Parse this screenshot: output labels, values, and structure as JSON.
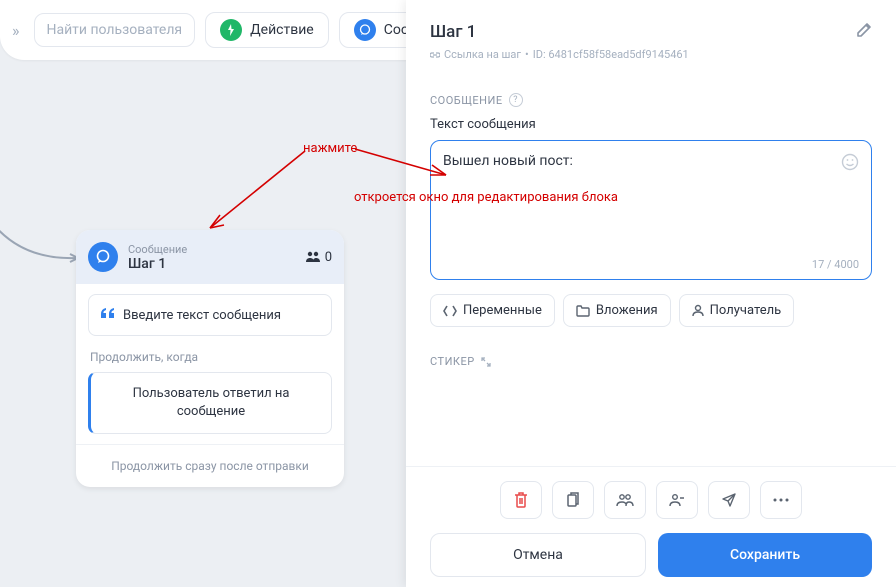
{
  "toolbar": {
    "search_placeholder": "Найти пользователя",
    "action_label": "Действие",
    "message_label": "Сооб"
  },
  "node": {
    "type_label": "Сообщение",
    "title": "Шаг 1",
    "user_count": "0",
    "enter_text": "Введите текст сообщения",
    "continue_label": "Продолжить, когда",
    "continue_text": "Пользователь ответил на сообщение",
    "foot_text": "Продолжить сразу после отправки"
  },
  "panel": {
    "title": "Шаг 1",
    "meta_link": "Ссылка на шаг",
    "meta_id": "ID: 6481cf58f58ead5df9145461",
    "section_message": "СООБЩЕНИЕ",
    "text_label": "Текст сообщения",
    "editor_value": "Вышел новый пост:",
    "counter": "17 / 4000",
    "btn_vars": "Переменные",
    "btn_attach": "Вложения",
    "btn_recipient": "Получатель",
    "section_sticker": "СТИКЕР",
    "btn_cancel": "Отмена",
    "btn_save": "Сохранить"
  },
  "annotations": {
    "press": "нажмите",
    "opens": "откроется окно для редактирования блока"
  }
}
